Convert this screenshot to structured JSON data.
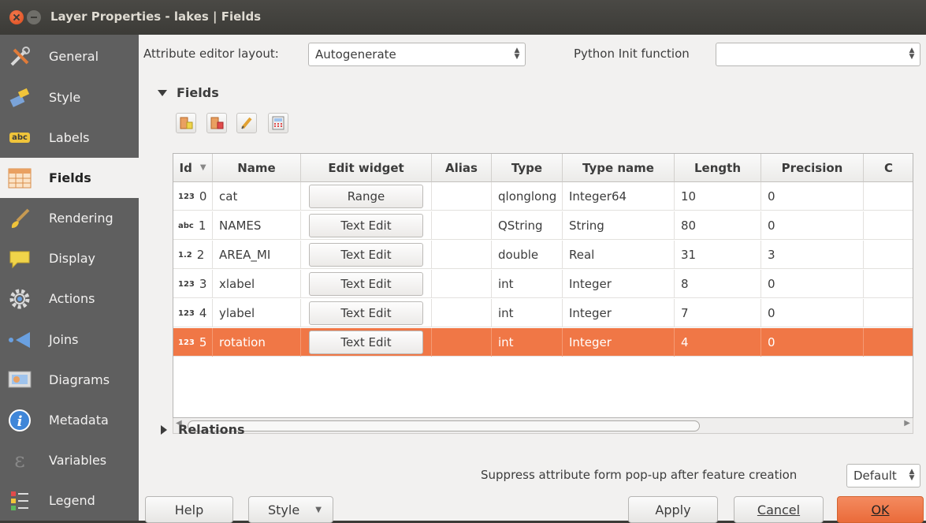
{
  "window": {
    "title": "Layer Properties - lakes | Fields"
  },
  "sidebar": {
    "items": [
      {
        "label": "General",
        "icon": "tools-icon"
      },
      {
        "label": "Style",
        "icon": "paintbrush-icon"
      },
      {
        "label": "Labels",
        "icon": "abc-label-icon"
      },
      {
        "label": "Fields",
        "icon": "table-icon",
        "active": true
      },
      {
        "label": "Rendering",
        "icon": "brush-icon"
      },
      {
        "label": "Display",
        "icon": "speech-bubble-icon"
      },
      {
        "label": "Actions",
        "icon": "gear-icon"
      },
      {
        "label": "Joins",
        "icon": "join-arrow-icon"
      },
      {
        "label": "Diagrams",
        "icon": "diagram-icon"
      },
      {
        "label": "Metadata",
        "icon": "info-icon"
      },
      {
        "label": "Variables",
        "icon": "epsilon-icon"
      },
      {
        "label": "Legend",
        "icon": "legend-icon"
      }
    ]
  },
  "top": {
    "layout_label": "Attribute editor layout:",
    "layout_value": "Autogenerate",
    "python_label": "Python Init function",
    "python_value": ""
  },
  "fields_section": {
    "title": "Fields"
  },
  "table": {
    "columns": [
      "Id",
      "Name",
      "Edit widget",
      "Alias",
      "Type",
      "Type name",
      "Length",
      "Precision",
      "C"
    ],
    "rows": [
      {
        "type_icon": "123",
        "id": "0",
        "name": "cat",
        "widget": "Range",
        "alias": "",
        "type": "qlonglong",
        "type_name": "Integer64",
        "length": "10",
        "precision": "0"
      },
      {
        "type_icon": "abc",
        "id": "1",
        "name": "NAMES",
        "widget": "Text Edit",
        "alias": "",
        "type": "QString",
        "type_name": "String",
        "length": "80",
        "precision": "0"
      },
      {
        "type_icon": "1.2",
        "id": "2",
        "name": "AREA_MI",
        "widget": "Text Edit",
        "alias": "",
        "type": "double",
        "type_name": "Real",
        "length": "31",
        "precision": "3"
      },
      {
        "type_icon": "123",
        "id": "3",
        "name": "xlabel",
        "widget": "Text Edit",
        "alias": "",
        "type": "int",
        "type_name": "Integer",
        "length": "8",
        "precision": "0"
      },
      {
        "type_icon": "123",
        "id": "4",
        "name": "ylabel",
        "widget": "Text Edit",
        "alias": "",
        "type": "int",
        "type_name": "Integer",
        "length": "7",
        "precision": "0"
      },
      {
        "type_icon": "123",
        "id": "5",
        "name": "rotation",
        "widget": "Text Edit",
        "alias": "",
        "type": "int",
        "type_name": "Integer",
        "length": "4",
        "precision": "0",
        "selected": true
      }
    ]
  },
  "relations_section": {
    "title": "Relations"
  },
  "suppress": {
    "label": "Suppress attribute form pop-up after feature creation",
    "value": "Default"
  },
  "buttons": {
    "help": "Help",
    "style": "Style",
    "apply": "Apply",
    "cancel": "Cancel",
    "ok": "OK"
  },
  "colors": {
    "accent": "#f07746",
    "sidebar": "#5f5f5f",
    "titlebar": "#3c3b37"
  }
}
